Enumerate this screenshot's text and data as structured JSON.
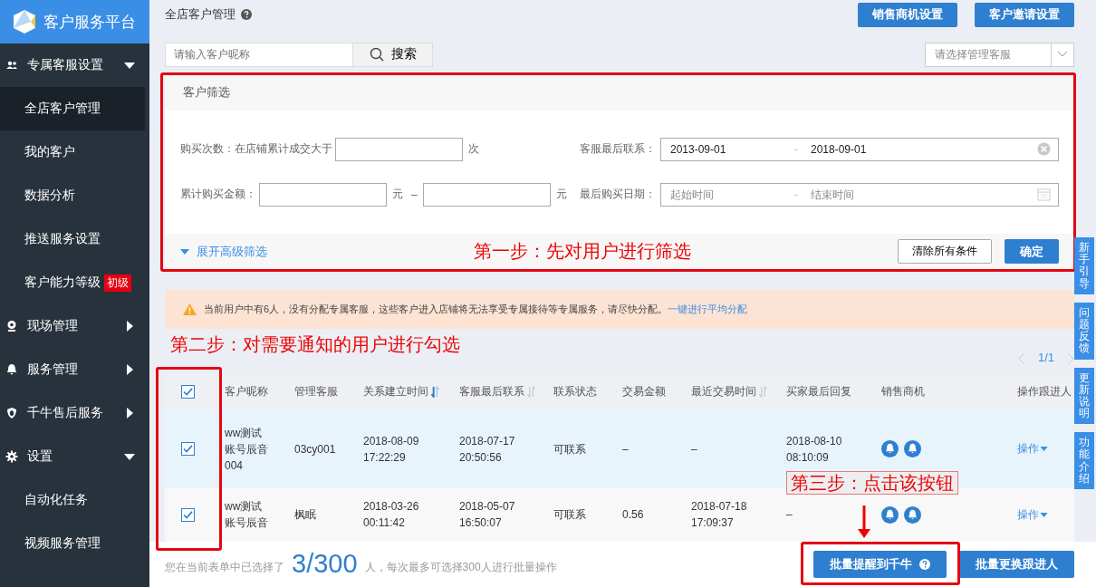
{
  "sidebar": {
    "logo": "客户服务平台",
    "items": [
      {
        "label": "专属客服设置",
        "expanded": true,
        "children": [
          {
            "label": "全店客户管理",
            "selected": true
          },
          {
            "label": "我的客户",
            "selected": false
          },
          {
            "label": "数据分析",
            "selected": false
          },
          {
            "label": "推送服务设置",
            "selected": false
          },
          {
            "label": "客户能力等级",
            "selected": false,
            "badge": "初级"
          }
        ]
      },
      {
        "label": "现场管理",
        "expanded": false
      },
      {
        "label": "服务管理",
        "expanded": false
      },
      {
        "label": "千牛售后服务",
        "expanded": false
      },
      {
        "label": "设置",
        "expanded": true,
        "children": [
          {
            "label": "自动化任务",
            "selected": false
          },
          {
            "label": "视频服务管理",
            "selected": false
          }
        ]
      }
    ]
  },
  "page_title": "全店客户管理",
  "header_buttons": [
    "销售商机设置",
    "客户邀请设置"
  ],
  "search": {
    "placeholder": "请输入客户昵称",
    "button": "搜索"
  },
  "manager_select": {
    "placeholder": "请选择管理客服"
  },
  "filters": {
    "title": "客户筛选",
    "fields": [
      {
        "kind": "number",
        "label": "购买次数：在店铺累计成交大于",
        "unit": "次"
      },
      {
        "kind": "date",
        "label": "客服最后联系：",
        "start": {
          "value": "2013-09-01"
        },
        "separator": "-",
        "end": {
          "value": "2018-09-01"
        },
        "clearable": true
      },
      {
        "kind": "range",
        "label": "累计购买金额：",
        "unit_from": "元",
        "dash": "–",
        "unit_to": "元"
      },
      {
        "kind": "date",
        "label": "最后购买日期：",
        "start": {
          "placeholder": "起始时间"
        },
        "separator": "-",
        "end": {
          "placeholder": "结束时间"
        },
        "clearable": false
      }
    ],
    "expand_link": "展开高级筛选",
    "clear_button": "清除所有条件",
    "confirm_button": "确定"
  },
  "alert": {
    "text": "当前用户中有6人，没有分配专属客服，这些客户进入店铺将无法享受专属接待等专属服务，请尽快分配。",
    "link": "一键进行平均分配"
  },
  "pagination": {
    "label": "1/1"
  },
  "table": {
    "all_checked": true,
    "columns": [
      {
        "label": "客户昵称",
        "sortable": false,
        "sorted": false
      },
      {
        "label": "管理客服",
        "sortable": false,
        "sorted": false
      },
      {
        "label": "关系建立时间",
        "sortable": true,
        "sorted": true
      },
      {
        "label": "客服最后联系",
        "sortable": true,
        "sorted": false
      },
      {
        "label": "联系状态",
        "sortable": false,
        "sorted": false
      },
      {
        "label": "交易金额",
        "sortable": false,
        "sorted": false
      },
      {
        "label": "最近交易时间",
        "sortable": true,
        "sorted": false
      },
      {
        "label": "买家最后回复",
        "sortable": false,
        "sorted": false
      },
      {
        "label": "销售商机",
        "sortable": false,
        "sorted": false
      },
      {
        "label": "操作跟进人",
        "sortable": false,
        "sorted": false
      }
    ],
    "rows": [
      {
        "checked": true,
        "highlighted": true,
        "cells": [
          "ww测试账号辰音004",
          "03cy001",
          "2018-08-09 17:22:29",
          "2018-07-17 20:50:56",
          "可联系",
          "–",
          "–",
          "2018-08-10 08:10:09"
        ],
        "action": "操作"
      },
      {
        "checked": true,
        "highlighted": false,
        "cells": [
          "ww测试账号辰音",
          "枫眠",
          "2018-03-26 00:11:42",
          "2018-05-07 16:50:07",
          "可联系",
          "0.56",
          "2018-07-18 17:09:37",
          "–"
        ],
        "action": "操作"
      }
    ]
  },
  "footer": {
    "prefix": "您在当前表单中已选择了",
    "count": "3/300",
    "suffix": "人，每次最多可选择300人进行批量操作",
    "buttons": [
      "批量提醒到千牛",
      "批量更换跟进人"
    ]
  },
  "annotations": [
    "第一步：先对用户进行筛选",
    "第二步：对需要通知的用户进行勾选",
    "第三步：点击该按钮"
  ],
  "side_tabs": [
    "新手引导",
    "问题反馈",
    "更新说明",
    "功能介绍"
  ]
}
